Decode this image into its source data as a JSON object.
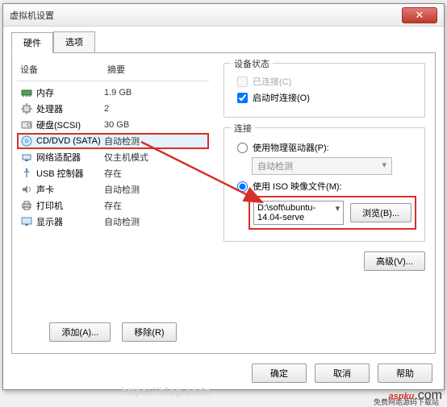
{
  "window": {
    "title": "虚拟机设置",
    "close": "✕"
  },
  "tabs": {
    "hardware": "硬件",
    "options": "选项"
  },
  "headers": {
    "device": "设备",
    "summary": "摘要"
  },
  "devices": [
    {
      "name": "内存",
      "summary": "1.9 GB",
      "icon": "memory-icon"
    },
    {
      "name": "处理器",
      "summary": "2",
      "icon": "cpu-icon"
    },
    {
      "name": "硬盘(SCSI)",
      "summary": "30 GB",
      "icon": "disk-icon"
    },
    {
      "name": "CD/DVD (SATA)",
      "summary": "自动检测",
      "icon": "cd-icon",
      "selected": true
    },
    {
      "name": "网络适配器",
      "summary": "仅主机模式",
      "icon": "net-icon"
    },
    {
      "name": "USB 控制器",
      "summary": "存在",
      "icon": "usb-icon"
    },
    {
      "name": "声卡",
      "summary": "自动检测",
      "icon": "sound-icon"
    },
    {
      "name": "打印机",
      "summary": "存在",
      "icon": "printer-icon"
    },
    {
      "name": "显示器",
      "summary": "自动检测",
      "icon": "display-icon"
    }
  ],
  "left_buttons": {
    "add": "添加(A)...",
    "remove": "移除(R)"
  },
  "status_group": {
    "title": "设备状态",
    "connected": "已连接(C)",
    "connect_at_poweron": "启动时连接(O)"
  },
  "conn_group": {
    "title": "连接",
    "use_physical": "使用物理驱动器(P):",
    "physical_value": "自动检测",
    "use_iso": "使用 ISO 映像文件(M):",
    "iso_path": "D:\\soft\\ubuntu-14.04-serve",
    "browse": "浏览(B)..."
  },
  "advanced": "高级(V)...",
  "bottom": {
    "ok": "确定",
    "cancel": "取消",
    "help": "帮助"
  },
  "watermark": "https://blog.csdn",
  "logo": {
    "text1": "asp",
    "text2": "ku",
    "tld": ".com",
    "sub": "免费网站源码下载站"
  }
}
